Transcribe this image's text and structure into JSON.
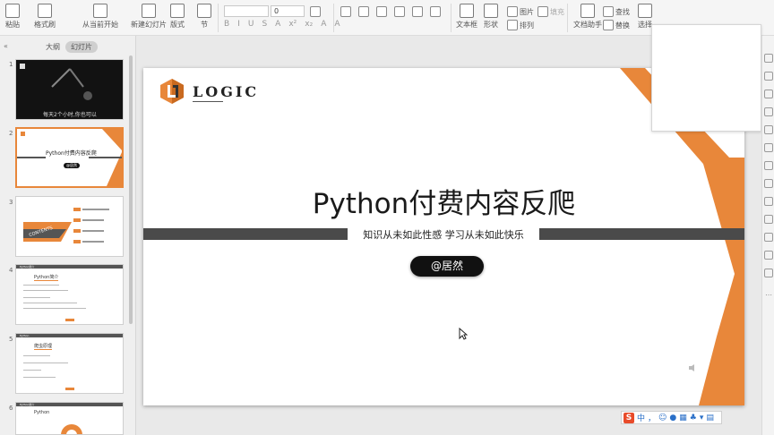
{
  "ribbon": {
    "paste_label": "粘贴",
    "format_painter_label": "格式刷",
    "from_current_label": "从当前开始",
    "new_slide_label": "新建幻灯片",
    "layout_label": "版式",
    "section_label": "节",
    "font_name_value": "",
    "font_size_value": "0",
    "format_buttons": [
      "B",
      "I",
      "U",
      "S",
      "A",
      "x²",
      "x₂",
      "A",
      "A"
    ],
    "textbox_label": "文本框",
    "shape_label": "形状",
    "picture_label": "图片",
    "arrange_label": "排列",
    "fill_label": "填充",
    "text_assistant_label": "文档助手",
    "find_label": "查找",
    "replace_label": "替换",
    "select_label": "选择"
  },
  "left_panel": {
    "collapse_icon": "«",
    "tab_outline": "大纲",
    "tab_slides": "幻灯片",
    "thumbnails": [
      {
        "num": "1",
        "caption": "每天2个小时,你也可以"
      },
      {
        "num": "2",
        "title": "Python付费内容反爬",
        "pill": "@居然"
      },
      {
        "num": "3",
        "label": "CONTENTS"
      },
      {
        "num": "4",
        "header": "Python简介",
        "item": "Python简介"
      },
      {
        "num": "5",
        "header": "Python",
        "item": "爬虫原理"
      },
      {
        "num": "6",
        "header": "Python简介",
        "item": "Python"
      }
    ]
  },
  "slide": {
    "logo_text": "LOGIC",
    "title": "Python付费内容反爬",
    "subtitle": "知识从未如此性感    学习从未如此快乐",
    "author": "@居然",
    "colors": {
      "orange": "#E8873A",
      "dark_band": "#4A4A4A",
      "pill": "#111111"
    }
  },
  "ime": {
    "logo": "S",
    "mode": "中",
    "punct": "，",
    "icons": [
      "emoji-icon",
      "mic-icon",
      "keyboard-icon",
      "skin-icon",
      "shirt-icon",
      "grid-icon"
    ]
  }
}
